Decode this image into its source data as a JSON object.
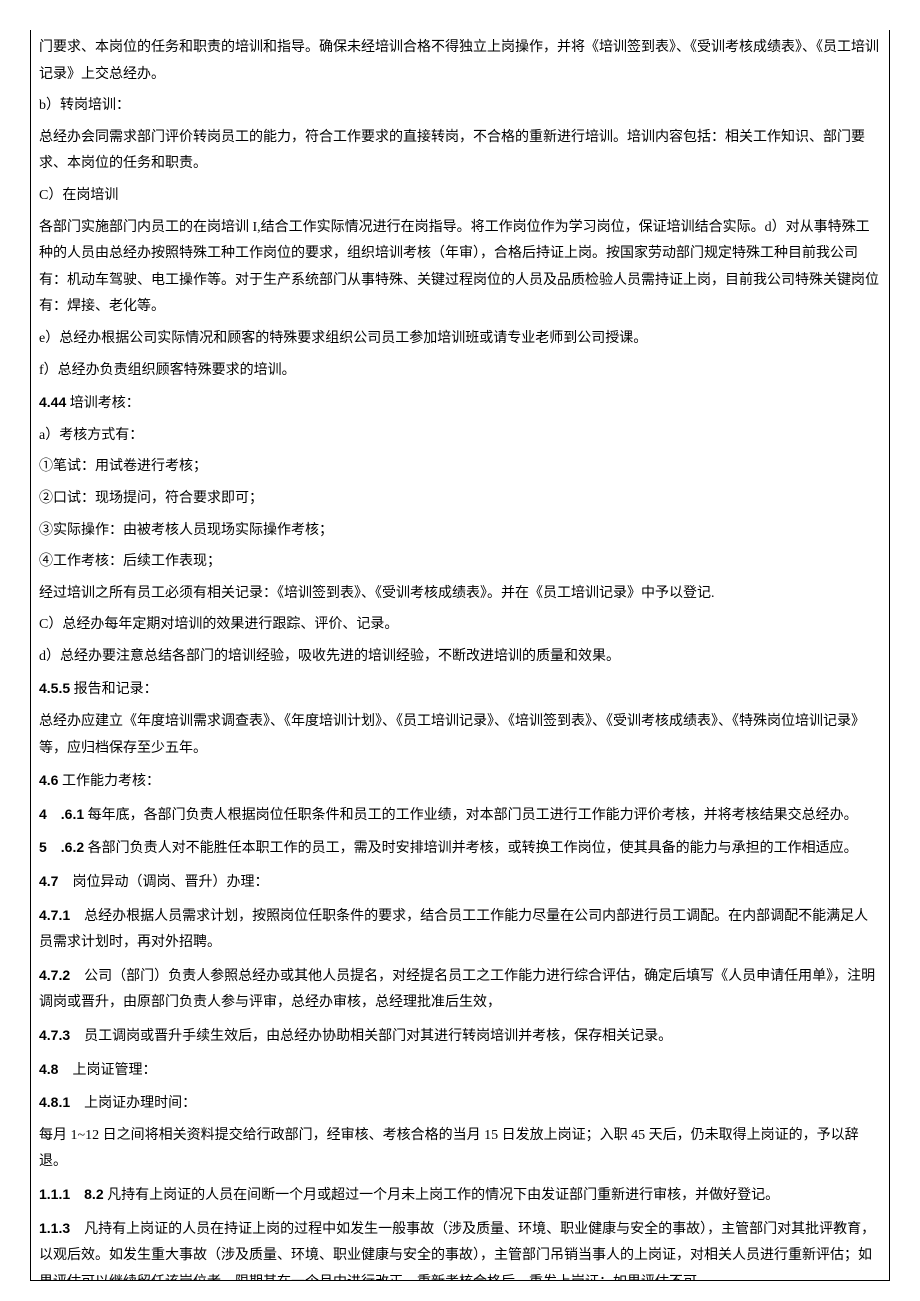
{
  "paragraphs": [
    {
      "plain": "门要求、本岗位的任务和职责的培训和指导。确保未经培训合格不得独立上岗操作，并将《培训签到表》、《受训考核成绩表》、《员工培训记录》上交总经办。"
    },
    {
      "plain": "b）转岗培训："
    },
    {
      "plain": "总经办会同需求部门评价转岗员工的能力，符合工作要求的直接转岗，不合格的重新进行培训。培训内容包括：相关工作知识、部门要求、本岗位的任务和职责。"
    },
    {
      "plain": "C）在岗培训"
    },
    {
      "plain": "各部门实施部门内员工的在岗培训 I,结合工作实际情况进行在岗指导。将工作岗位作为学习岗位，保证培训结合实际。d）对从事特殊工种的人员由总经办按照特殊工种工作岗位的要求，组织培训考核（年审），合格后持证上岗。按国家劳动部门规定特殊工种目前我公司有：机动车驾驶、电工操作等。对于生产系统部门从事特殊、关键过程岗位的人员及品质检验人员需持证上岗，目前我公司特殊关键岗位有：焊接、老化等。"
    },
    {
      "plain": "e）总经办根据公司实际情况和顾客的特殊要求组织公司员工参加培训班或请专业老师到公司授课。"
    },
    {
      "plain": "f）总经办负责组织顾客特殊要求的培训。"
    },
    {
      "bold": "4.44",
      "rest": " 培训考核："
    },
    {
      "plain": "a）考核方式有："
    },
    {
      "plain": "①笔试：用试卷进行考核；"
    },
    {
      "plain": "②口试：现场提问，符合要求即可；"
    },
    {
      "plain": "③实际操作：由被考核人员现场实际操作考核；"
    },
    {
      "plain": "④工作考核：后续工作表现；"
    },
    {
      "plain": "经过培训之所有员工必须有相关记录：《培训签到表》、《受训考核成绩表》。并在《员工培训记录》中予以登记."
    },
    {
      "plain": "C）总经办每年定期对培训的效果进行跟踪、评价、记录。"
    },
    {
      "plain": "d）总经办要注意总结各部门的培训经验，吸收先进的培训经验，不断改进培训的质量和效果。"
    },
    {
      "bold": "4.5.5",
      "rest": " 报告和记录："
    },
    {
      "plain": "总经办应建立《年度培训需求调查表》、《年度培训计划》、《员工培训记录》、《培训签到表》、《受训考核成绩表》、《特殊岗位培训记录》等，应归档保存至少五年。"
    },
    {
      "bold": "4.6",
      "rest": " 工作能力考核："
    },
    {
      "bold": "4　.6.1",
      "rest": " 每年底，各部门负责人根据岗位任职条件和员工的工作业绩，对本部门员工进行工作能力评价考核，并将考核结果交总经办。"
    },
    {
      "bold": "5　.6.2",
      "rest": " 各部门负责人对不能胜任本职工作的员工，需及时安排培训并考核，或转换工作岗位，使其具备的能力与承担的工作相适应。"
    },
    {
      "bold": "4.7",
      "rest": "　岗位异动（调岗、晋升）办理："
    },
    {
      "bold": "4.7.1",
      "rest": "　总经办根据人员需求计划，按照岗位任职条件的要求，结合员工工作能力尽量在公司内部进行员工调配。在内部调配不能满足人员需求计划时，再对外招聘。"
    },
    {
      "bold": "4.7.2",
      "rest": "　公司（部门）负责人参照总经办或其他人员提名，对经提名员工之工作能力进行综合评估，确定后填写《人员申请任用单》，注明调岗或晋升，由原部门负责人参与评审，总经办审核，总经理批准后生效，"
    },
    {
      "bold": "4.7.3",
      "rest": "　员工调岗或晋升手续生效后，由总经办协助相关部门对其进行转岗培训并考核，保存相关记录。"
    },
    {
      "bold": "4.8",
      "rest": "　上岗证管理："
    },
    {
      "bold": "4.8.1",
      "rest": "　上岗证办理时间："
    },
    {
      "plain": "每月 1~12 日之间将相关资料提交给行政部门，经审核、考核合格的当月 15 日发放上岗证；入职 45 天后，仍未取得上岗证的，予以辞退。"
    },
    {
      "bold": "1.1.1　8.2",
      "rest": " 凡持有上岗证的人员在间断一个月或超过一个月未上岗工作的情况下由发证部门重新进行审核，并做好登记。"
    },
    {
      "bold": "1.1.3",
      "rest": "　凡持有上岗证的人员在持证上岗的过程中如发生一般事故（涉及质量、环境、职业健康与安全的事故），主管部门对其批评教育，以观后效。如发生重大事故（涉及质量、环境、职业健康与安全的事故），主管部门吊销当事人的上岗证，对相关人员进行重新评估；如果评估可以继续留任该岗位者，限期其在一个月内进行改正，重新考核合格后，重发上岗证；如果评估不可"
    }
  ]
}
